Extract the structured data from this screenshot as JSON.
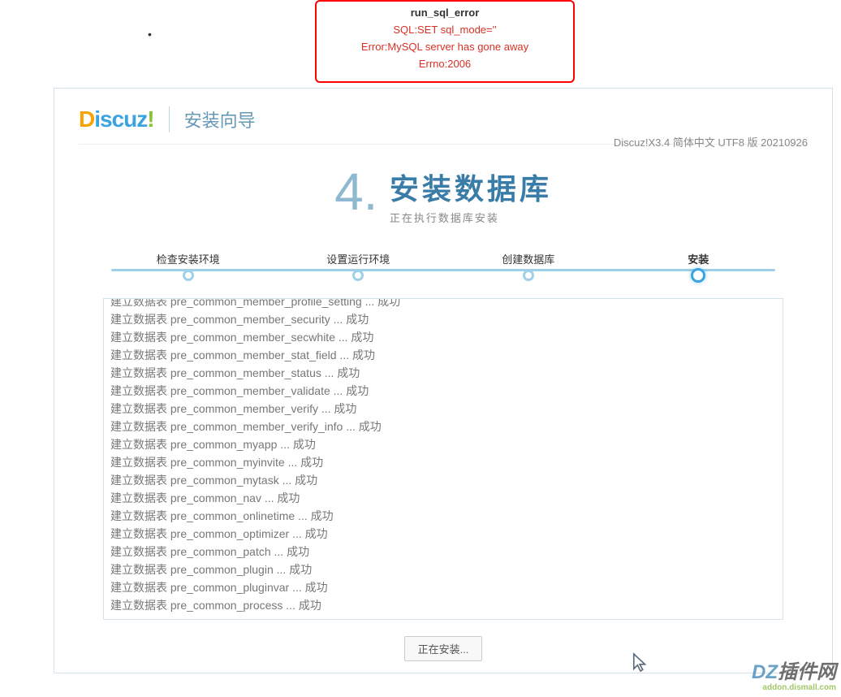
{
  "error": {
    "title": "run_sql_error",
    "sql": "SQL:SET sql_mode=''",
    "message": "Error:MySQL server has gone away",
    "errno": "Errno:2006"
  },
  "logo": {
    "d": "D",
    "rest": "iscuz",
    "bang": "!"
  },
  "wizard_title": "安装向导",
  "version": "Discuz!X3.4 简体中文 UTF8 版 20210926",
  "step": {
    "number": "4",
    "dot": ".",
    "title": "安装数据库",
    "subtitle": "正在执行数据库安装"
  },
  "progress": [
    {
      "label": "检查安装环境",
      "active": false
    },
    {
      "label": "设置运行环境",
      "active": false
    },
    {
      "label": "创建数据库",
      "active": false
    },
    {
      "label": "安装",
      "active": true
    }
  ],
  "log": {
    "prefix": "建立数据表 ",
    "suffix": " ... 成功",
    "truncated_first": "建立数据表 pre_common_member_profile_setting ... 成功",
    "tables": [
      "pre_common_member_security",
      "pre_common_member_secwhite",
      "pre_common_member_stat_field",
      "pre_common_member_status",
      "pre_common_member_validate",
      "pre_common_member_verify",
      "pre_common_member_verify_info",
      "pre_common_myapp",
      "pre_common_myinvite",
      "pre_common_mytask",
      "pre_common_nav",
      "pre_common_onlinetime",
      "pre_common_optimizer",
      "pre_common_patch",
      "pre_common_plugin",
      "pre_common_pluginvar",
      "pre_common_process"
    ]
  },
  "button_label": "正在安装...",
  "watermark": {
    "dz": "DZ",
    "cn": "插件网",
    "sub": "addon.dismall.com"
  }
}
